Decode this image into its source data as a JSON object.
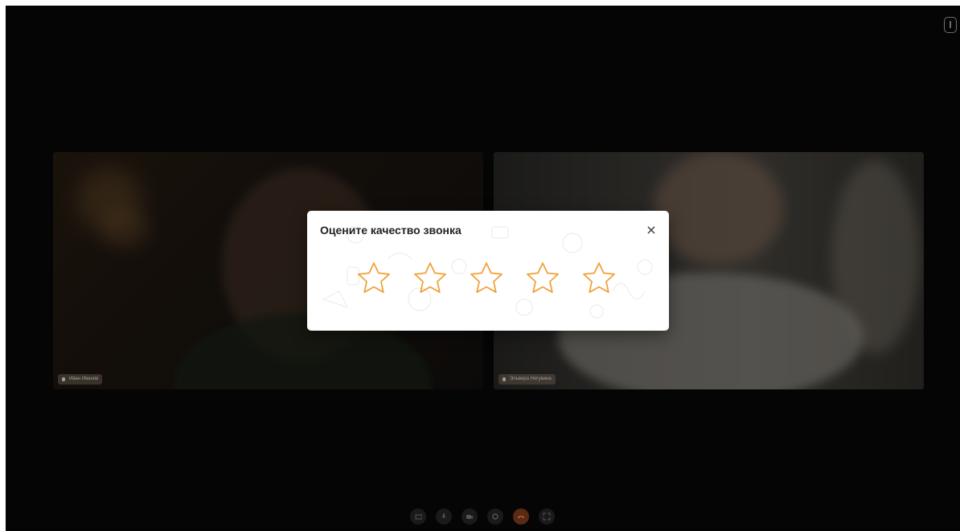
{
  "participants": [
    {
      "name": "Иван Иванов"
    },
    {
      "name": "Эльвира Нигувина"
    }
  ],
  "rating_modal": {
    "title": "Оцените качество звонка",
    "close_label": "×",
    "max_stars": 5,
    "selected": 0,
    "star_color": "#F0A23B"
  },
  "toolbar": {
    "buttons": [
      {
        "icon": "screen-share-icon"
      },
      {
        "icon": "microphone-icon"
      },
      {
        "icon": "camera-icon"
      },
      {
        "icon": "settings-icon"
      },
      {
        "icon": "end-call-icon",
        "color": "#E8581C"
      },
      {
        "icon": "fullscreen-icon"
      }
    ]
  },
  "colors": {
    "background": "#050505",
    "accent": "#F0A23B"
  }
}
